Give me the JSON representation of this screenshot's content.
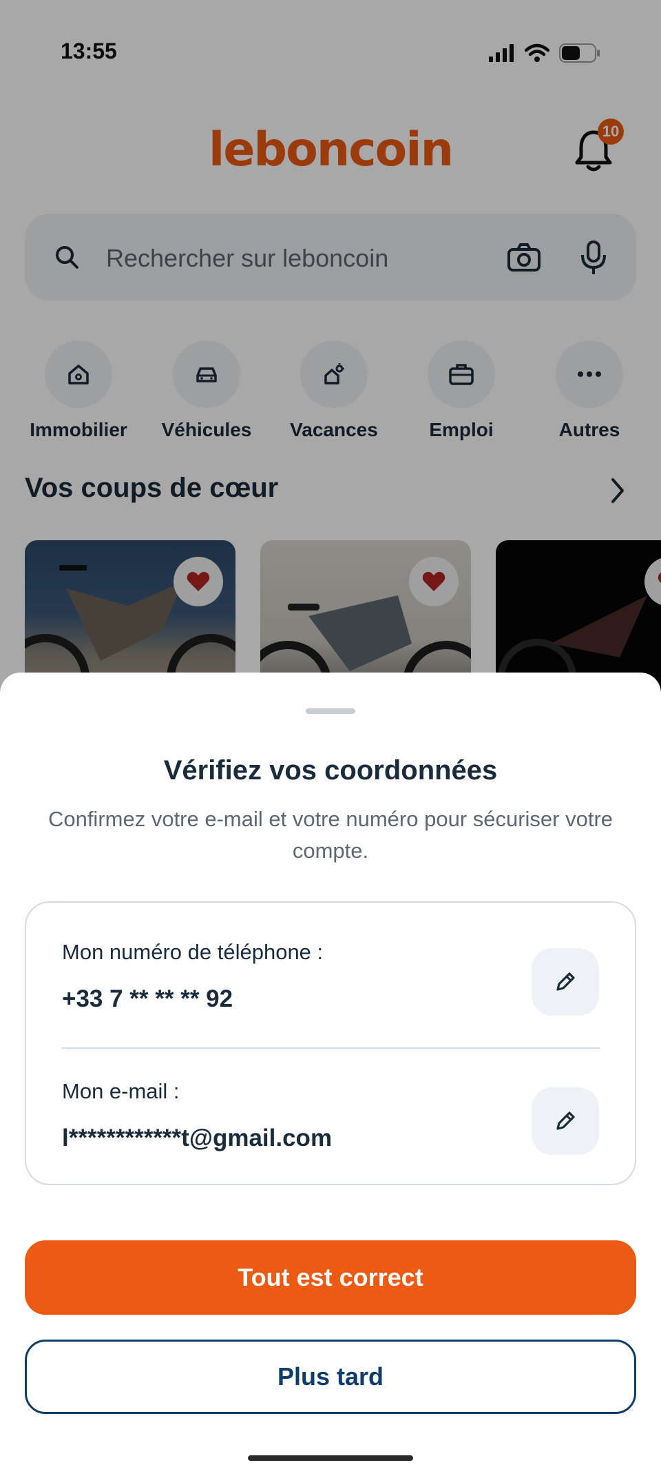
{
  "status_bar": {
    "time": "13:55"
  },
  "header": {
    "logo": "leboncoin",
    "notification_count": "10"
  },
  "search": {
    "placeholder": "Rechercher sur leboncoin"
  },
  "categories": [
    {
      "label": "Immobilier",
      "icon": "house-icon"
    },
    {
      "label": "Véhicules",
      "icon": "car-icon"
    },
    {
      "label": "Vacances",
      "icon": "vacation-icon"
    },
    {
      "label": "Emploi",
      "icon": "briefcase-icon"
    },
    {
      "label": "Autres",
      "icon": "more-icon"
    }
  ],
  "favorites": {
    "title": "Vos coups de cœur"
  },
  "sheet": {
    "title": "Vérifiez vos coordonnées",
    "subtitle": "Confirmez votre e-mail et votre numéro pour sécuriser votre compte.",
    "phone_label": "Mon numéro de téléphone :",
    "phone_value": "+33 7 ** ** ** 92",
    "email_label": "Mon e-mail :",
    "email_value": "l************t@gmail.com",
    "confirm_button": "Tout est correct",
    "later_button": "Plus tard"
  },
  "colors": {
    "brand": "#ec5a13",
    "navy": "#0e3c6c",
    "text": "#1a2b3c"
  }
}
